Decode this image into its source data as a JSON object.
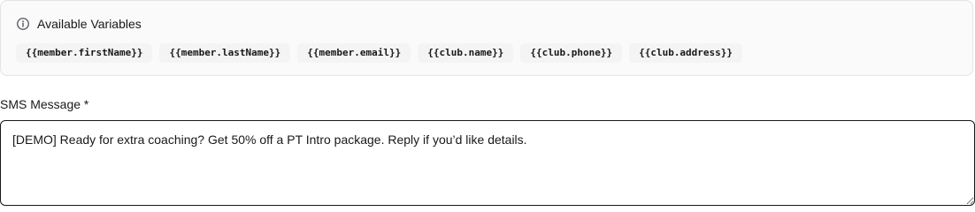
{
  "variables_panel": {
    "title": "Available Variables",
    "icon": "info-icon",
    "variables": [
      "{{member.firstName}}",
      "{{member.lastName}}",
      "{{member.email}}",
      "{{club.name}}",
      "{{club.phone}}",
      "{{club.address}}"
    ]
  },
  "sms_field": {
    "label": "SMS Message *",
    "value": "[DEMO] Ready for extra coaching? Get 50% off a PT Intro package. Reply if you’d like details."
  }
}
